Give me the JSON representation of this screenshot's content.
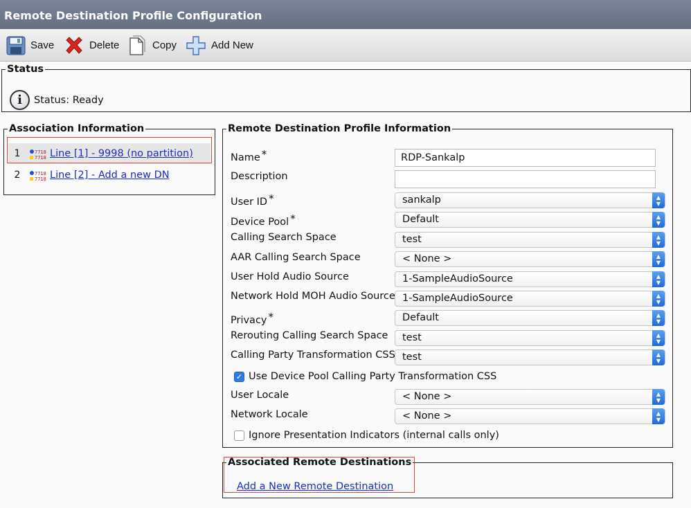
{
  "title": "Remote Destination Profile Configuration",
  "toolbar": {
    "save": "Save",
    "delete": "Delete",
    "copy": "Copy",
    "add_new": "Add New"
  },
  "status": {
    "legend": "Status",
    "text": "Status: Ready"
  },
  "association": {
    "legend": "Association Information",
    "rows": [
      {
        "num": "1",
        "label": "Line [1] - 9998 (no partition)"
      },
      {
        "num": "2",
        "label": "Line [2] - Add a new DN"
      }
    ]
  },
  "profile": {
    "legend": "Remote Destination Profile Information",
    "required_mark": "*",
    "fields": {
      "name": {
        "label": "Name",
        "value": "RDP-Sankalp"
      },
      "description": {
        "label": "Description",
        "value": ""
      },
      "user_id": {
        "label": "User ID",
        "value": "sankalp"
      },
      "device_pool": {
        "label": "Device Pool",
        "value": "Default"
      },
      "css": {
        "label": "Calling Search Space",
        "value": "test"
      },
      "aar_css": {
        "label": "AAR Calling Search Space",
        "value": "< None >"
      },
      "user_hold": {
        "label": "User Hold Audio Source",
        "value": "1-SampleAudioSource"
      },
      "network_hold": {
        "label": "Network Hold MOH Audio Source",
        "value": "1-SampleAudioSource"
      },
      "privacy": {
        "label": "Privacy",
        "value": "Default"
      },
      "rerouting_css": {
        "label": "Rerouting Calling Search Space",
        "value": "test"
      },
      "cpt_css": {
        "label": "Calling Party Transformation CSS",
        "value": "test"
      },
      "user_locale": {
        "label": "User Locale",
        "value": "< None >"
      },
      "network_locale": {
        "label": "Network Locale",
        "value": "< None >"
      }
    },
    "use_device_pool_cpt": {
      "label": "Use Device Pool Calling Party Transformation CSS",
      "checked": true
    },
    "ignore_presentation": {
      "label": "Ignore Presentation Indicators (internal calls only)",
      "checked": false
    }
  },
  "remote_destinations": {
    "legend": "Associated Remote Destinations",
    "add_link": "Add a New Remote Destination"
  },
  "icons": {
    "save": "floppy-disk-icon",
    "delete": "red-x-icon",
    "copy": "copy-document-icon",
    "add_new": "blue-plus-icon",
    "status": "info-icon",
    "line": "phone-line-icon"
  },
  "colors": {
    "titlebar": "#6b7587",
    "link": "#1a2ec2",
    "highlight": "#e2453a",
    "select_arrow": "#2d7de0"
  }
}
